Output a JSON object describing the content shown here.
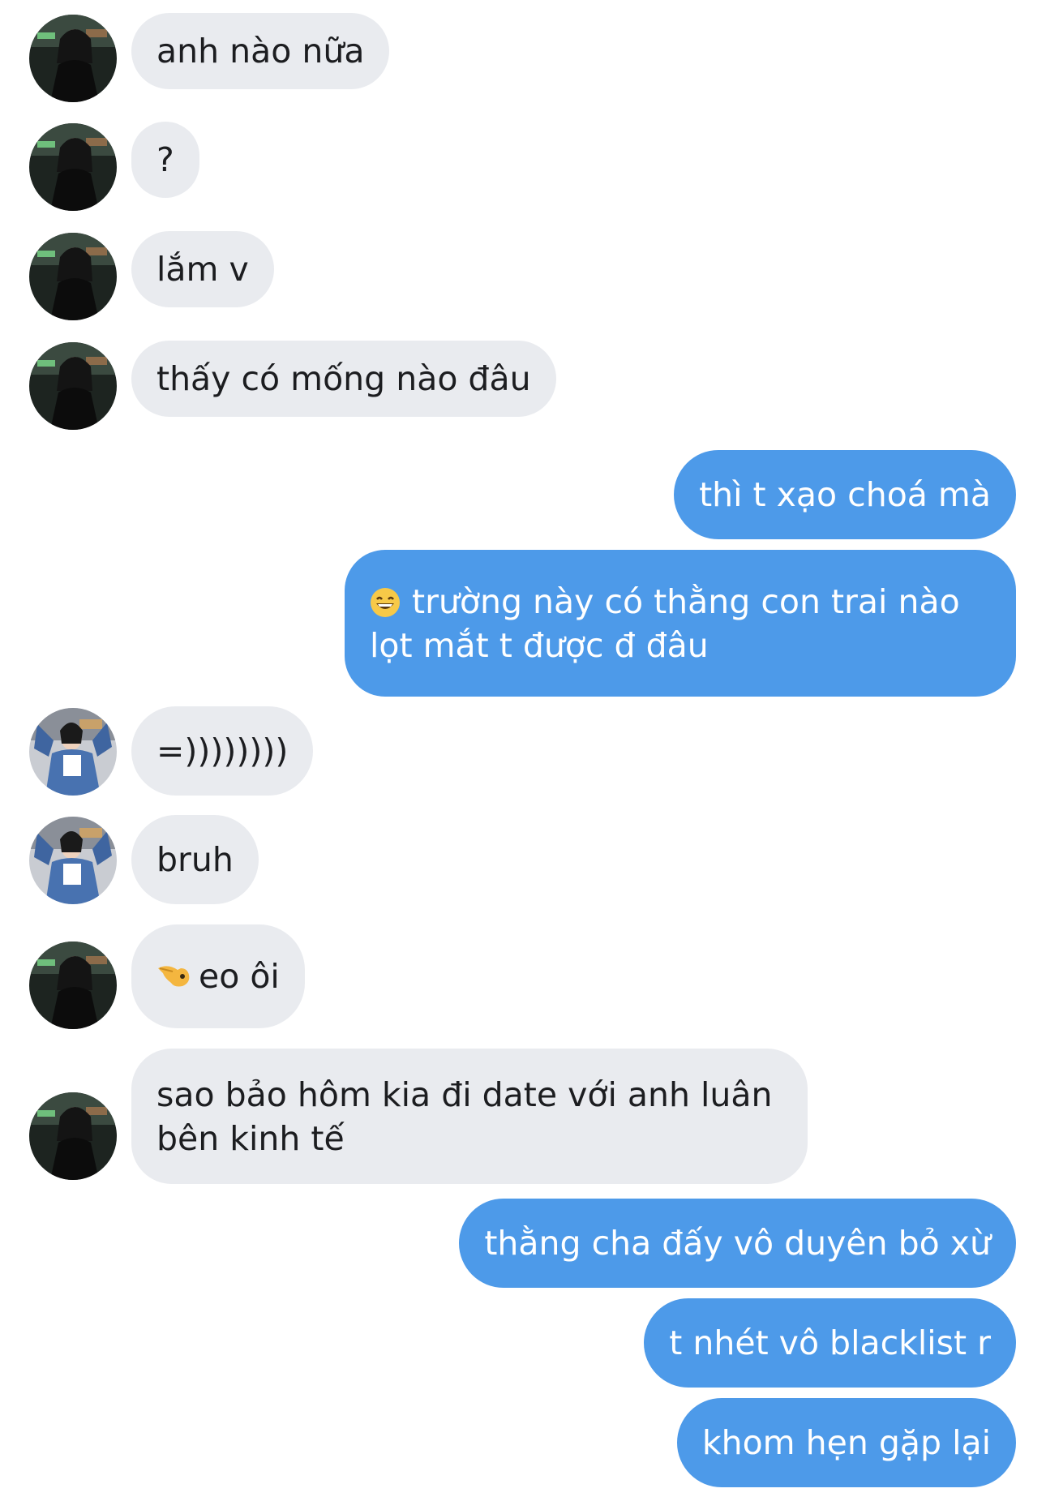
{
  "colors": {
    "incoming_bubble": "#e9ebef",
    "outgoing_bubble": "#4d9ae9",
    "incoming_text": "#1c1d20",
    "outgoing_text": "#ffffff"
  },
  "messages": [
    {
      "sender": "other",
      "avatar": "avatar-night-photo",
      "text": "anh nào nữa"
    },
    {
      "sender": "other",
      "avatar": "avatar-night-photo",
      "text": "?"
    },
    {
      "sender": "other",
      "avatar": "avatar-night-photo",
      "text": "lắm v"
    },
    {
      "sender": "other",
      "avatar": "avatar-night-photo",
      "text": "thấy có mống nào đâu"
    },
    {
      "sender": "me",
      "text": "thì t xạo choá mà"
    },
    {
      "sender": "me",
      "emoji": "grinning-face-icon",
      "text": "trường này có thằng con trai nào lọt mắt t được đ đâu"
    },
    {
      "sender": "other",
      "avatar": "avatar-denim-jacket",
      "text": "=))))))))"
    },
    {
      "sender": "other",
      "avatar": "avatar-denim-jacket",
      "text": "bruh"
    },
    {
      "sender": "other",
      "avatar": "avatar-night-photo",
      "emoji": "pointing-hand-icon",
      "text": "eo ôi"
    },
    {
      "sender": "other",
      "avatar": "avatar-night-photo",
      "text": "sao bảo hôm kia đi date với anh luân bên kinh tế"
    },
    {
      "sender": "me",
      "text": "thằng cha đấy vô duyên bỏ xừ"
    },
    {
      "sender": "me",
      "text": "t nhét vô blacklist r"
    },
    {
      "sender": "me",
      "text": "khom hẹn gặp lại"
    }
  ]
}
